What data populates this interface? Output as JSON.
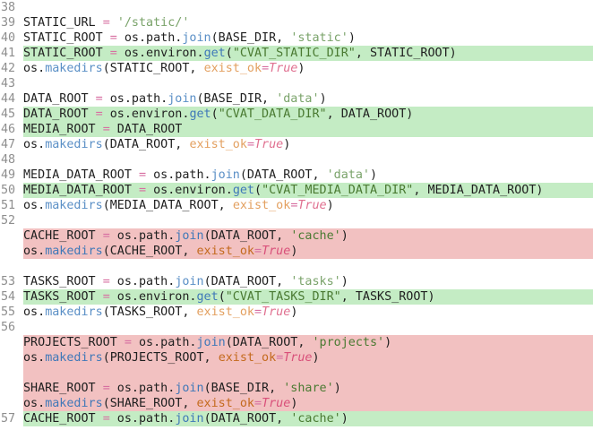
{
  "diff": {
    "lines": [
      {
        "type": "ctx",
        "num": "38",
        "tokens": []
      },
      {
        "type": "ctx",
        "num": "39",
        "tokens": [
          {
            "t": "STATIC_URL ",
            "c": "plain"
          },
          {
            "t": "=",
            "c": "op"
          },
          {
            "t": " ",
            "c": "plain"
          },
          {
            "t": "'/static/'",
            "c": "str"
          }
        ]
      },
      {
        "type": "ctx",
        "num": "40",
        "tokens": [
          {
            "t": "STATIC_ROOT ",
            "c": "plain"
          },
          {
            "t": "=",
            "c": "op"
          },
          {
            "t": " os.path.",
            "c": "plain"
          },
          {
            "t": "join",
            "c": "attr"
          },
          {
            "t": "(BASE_DIR, ",
            "c": "plain"
          },
          {
            "t": "'static'",
            "c": "str"
          },
          {
            "t": ")",
            "c": "plain"
          }
        ]
      },
      {
        "type": "add",
        "num": "41",
        "tokens": [
          {
            "t": "STATIC_ROOT ",
            "c": "plain"
          },
          {
            "t": "=",
            "c": "op"
          },
          {
            "t": " os.environ.",
            "c": "plain"
          },
          {
            "t": "get",
            "c": "attr"
          },
          {
            "t": "(",
            "c": "plain"
          },
          {
            "t": "\"CVAT_STATIC_DIR\"",
            "c": "str"
          },
          {
            "t": ", STATIC_ROOT)",
            "c": "plain"
          }
        ]
      },
      {
        "type": "ctx",
        "num": "42",
        "tokens": [
          {
            "t": "os.",
            "c": "plain"
          },
          {
            "t": "makedirs",
            "c": "attr"
          },
          {
            "t": "(STATIC_ROOT, ",
            "c": "plain"
          },
          {
            "t": "exist_ok",
            "c": "kw"
          },
          {
            "t": "=",
            "c": "op"
          },
          {
            "t": "True",
            "c": "lit"
          },
          {
            "t": ")",
            "c": "plain"
          }
        ]
      },
      {
        "type": "ctx",
        "num": "43",
        "tokens": []
      },
      {
        "type": "ctx",
        "num": "44",
        "tokens": [
          {
            "t": "DATA_ROOT ",
            "c": "plain"
          },
          {
            "t": "=",
            "c": "op"
          },
          {
            "t": " os.path.",
            "c": "plain"
          },
          {
            "t": "join",
            "c": "attr"
          },
          {
            "t": "(BASE_DIR, ",
            "c": "plain"
          },
          {
            "t": "'data'",
            "c": "str"
          },
          {
            "t": ")",
            "c": "plain"
          }
        ]
      },
      {
        "type": "add",
        "num": "45",
        "tokens": [
          {
            "t": "DATA_ROOT ",
            "c": "plain"
          },
          {
            "t": "=",
            "c": "op"
          },
          {
            "t": " os.environ.",
            "c": "plain"
          },
          {
            "t": "get",
            "c": "attr"
          },
          {
            "t": "(",
            "c": "plain"
          },
          {
            "t": "\"CVAT_DATA_DIR\"",
            "c": "str"
          },
          {
            "t": ", DATA_ROOT)",
            "c": "plain"
          }
        ]
      },
      {
        "type": "add",
        "num": "46",
        "tokens": [
          {
            "t": "MEDIA_ROOT ",
            "c": "plain"
          },
          {
            "t": "=",
            "c": "op"
          },
          {
            "t": " DATA_ROOT",
            "c": "plain"
          }
        ]
      },
      {
        "type": "ctx",
        "num": "47",
        "tokens": [
          {
            "t": "os.",
            "c": "plain"
          },
          {
            "t": "makedirs",
            "c": "attr"
          },
          {
            "t": "(DATA_ROOT, ",
            "c": "plain"
          },
          {
            "t": "exist_ok",
            "c": "kw"
          },
          {
            "t": "=",
            "c": "op"
          },
          {
            "t": "True",
            "c": "lit"
          },
          {
            "t": ")",
            "c": "plain"
          }
        ]
      },
      {
        "type": "ctx",
        "num": "48",
        "tokens": []
      },
      {
        "type": "ctx",
        "num": "49",
        "tokens": [
          {
            "t": "MEDIA_DATA_ROOT ",
            "c": "plain"
          },
          {
            "t": "=",
            "c": "op"
          },
          {
            "t": " os.path.",
            "c": "plain"
          },
          {
            "t": "join",
            "c": "attr"
          },
          {
            "t": "(DATA_ROOT, ",
            "c": "plain"
          },
          {
            "t": "'data'",
            "c": "str"
          },
          {
            "t": ")",
            "c": "plain"
          }
        ]
      },
      {
        "type": "add",
        "num": "50",
        "tokens": [
          {
            "t": "MEDIA_DATA_ROOT ",
            "c": "plain"
          },
          {
            "t": "=",
            "c": "op"
          },
          {
            "t": " os.environ.",
            "c": "plain"
          },
          {
            "t": "get",
            "c": "attr"
          },
          {
            "t": "(",
            "c": "plain"
          },
          {
            "t": "\"CVAT_MEDIA_DATA_DIR\"",
            "c": "str"
          },
          {
            "t": ", MEDIA_DATA_ROOT)",
            "c": "plain"
          }
        ]
      },
      {
        "type": "ctx",
        "num": "51",
        "tokens": [
          {
            "t": "os.",
            "c": "plain"
          },
          {
            "t": "makedirs",
            "c": "attr"
          },
          {
            "t": "(MEDIA_DATA_ROOT, ",
            "c": "plain"
          },
          {
            "t": "exist_ok",
            "c": "kw"
          },
          {
            "t": "=",
            "c": "op"
          },
          {
            "t": "True",
            "c": "lit"
          },
          {
            "t": ")",
            "c": "plain"
          }
        ]
      },
      {
        "type": "ctx",
        "num": "52",
        "tokens": []
      },
      {
        "type": "del",
        "num": "",
        "tokens": [
          {
            "t": "CACHE_ROOT ",
            "c": "plain"
          },
          {
            "t": "=",
            "c": "op"
          },
          {
            "t": " os.path.",
            "c": "plain"
          },
          {
            "t": "join",
            "c": "attr"
          },
          {
            "t": "(DATA_ROOT, ",
            "c": "plain"
          },
          {
            "t": "'cache'",
            "c": "str"
          },
          {
            "t": ")",
            "c": "plain"
          }
        ]
      },
      {
        "type": "del",
        "num": "",
        "tokens": [
          {
            "t": "os.",
            "c": "plain"
          },
          {
            "t": "makedirs",
            "c": "attr"
          },
          {
            "t": "(CACHE_ROOT, ",
            "c": "plain"
          },
          {
            "t": "exist_ok",
            "c": "kw"
          },
          {
            "t": "=",
            "c": "op"
          },
          {
            "t": "True",
            "c": "lit"
          },
          {
            "t": ")",
            "c": "plain"
          }
        ]
      },
      {
        "type": "ctx",
        "num": "",
        "tokens": []
      },
      {
        "type": "ctx",
        "num": "53",
        "tokens": [
          {
            "t": "TASKS_ROOT ",
            "c": "plain"
          },
          {
            "t": "=",
            "c": "op"
          },
          {
            "t": " os.path.",
            "c": "plain"
          },
          {
            "t": "join",
            "c": "attr"
          },
          {
            "t": "(DATA_ROOT, ",
            "c": "plain"
          },
          {
            "t": "'tasks'",
            "c": "str"
          },
          {
            "t": ")",
            "c": "plain"
          }
        ]
      },
      {
        "type": "add",
        "num": "54",
        "tokens": [
          {
            "t": "TASKS_ROOT ",
            "c": "plain"
          },
          {
            "t": "=",
            "c": "op"
          },
          {
            "t": " os.environ.",
            "c": "plain"
          },
          {
            "t": "get",
            "c": "attr"
          },
          {
            "t": "(",
            "c": "plain"
          },
          {
            "t": "\"CVAT_TASKS_DIR\"",
            "c": "str"
          },
          {
            "t": ", TASKS_ROOT)",
            "c": "plain"
          }
        ]
      },
      {
        "type": "ctx",
        "num": "55",
        "tokens": [
          {
            "t": "os.",
            "c": "plain"
          },
          {
            "t": "makedirs",
            "c": "attr"
          },
          {
            "t": "(TASKS_ROOT, ",
            "c": "plain"
          },
          {
            "t": "exist_ok",
            "c": "kw"
          },
          {
            "t": "=",
            "c": "op"
          },
          {
            "t": "True",
            "c": "lit"
          },
          {
            "t": ")",
            "c": "plain"
          }
        ]
      },
      {
        "type": "ctx",
        "num": "56",
        "tokens": []
      },
      {
        "type": "del",
        "num": "",
        "tokens": [
          {
            "t": "PROJECTS_ROOT ",
            "c": "plain"
          },
          {
            "t": "=",
            "c": "op"
          },
          {
            "t": " os.path.",
            "c": "plain"
          },
          {
            "t": "join",
            "c": "attr"
          },
          {
            "t": "(DATA_ROOT, ",
            "c": "plain"
          },
          {
            "t": "'projects'",
            "c": "str"
          },
          {
            "t": ")",
            "c": "plain"
          }
        ]
      },
      {
        "type": "del",
        "num": "",
        "tokens": [
          {
            "t": "os.",
            "c": "plain"
          },
          {
            "t": "makedirs",
            "c": "attr"
          },
          {
            "t": "(PROJECTS_ROOT, ",
            "c": "plain"
          },
          {
            "t": "exist_ok",
            "c": "kw"
          },
          {
            "t": "=",
            "c": "op"
          },
          {
            "t": "True",
            "c": "lit"
          },
          {
            "t": ")",
            "c": "plain"
          }
        ]
      },
      {
        "type": "del",
        "num": "",
        "tokens": []
      },
      {
        "type": "del",
        "num": "",
        "tokens": [
          {
            "t": "SHARE_ROOT ",
            "c": "plain"
          },
          {
            "t": "=",
            "c": "op"
          },
          {
            "t": " os.path.",
            "c": "plain"
          },
          {
            "t": "join",
            "c": "attr"
          },
          {
            "t": "(BASE_DIR, ",
            "c": "plain"
          },
          {
            "t": "'share'",
            "c": "str"
          },
          {
            "t": ")",
            "c": "plain"
          }
        ]
      },
      {
        "type": "del",
        "num": "",
        "tokens": [
          {
            "t": "os.",
            "c": "plain"
          },
          {
            "t": "makedirs",
            "c": "attr"
          },
          {
            "t": "(SHARE_ROOT, ",
            "c": "plain"
          },
          {
            "t": "exist_ok",
            "c": "kw"
          },
          {
            "t": "=",
            "c": "op"
          },
          {
            "t": "True",
            "c": "lit"
          },
          {
            "t": ")",
            "c": "plain"
          }
        ]
      },
      {
        "type": "add",
        "num": "57",
        "tokens": [
          {
            "t": "CACHE_ROOT ",
            "c": "plain"
          },
          {
            "t": "=",
            "c": "op"
          },
          {
            "t": " os.path.",
            "c": "plain"
          },
          {
            "t": "join",
            "c": "attr"
          },
          {
            "t": "(DATA_ROOT, ",
            "c": "plain"
          },
          {
            "t": "'cache'",
            "c": "str"
          },
          {
            "t": ")",
            "c": "plain"
          }
        ]
      }
    ]
  },
  "colors": {
    "added_bg": "#c4ecc4",
    "removed_bg": "#f2c1c1",
    "line_number": "#8e8e8e",
    "string": "#4a7a32",
    "attribute": "#3f78b8",
    "keyword_arg": "#c46a1e",
    "literal": "#d9507a",
    "operator": "#d76fa1"
  }
}
